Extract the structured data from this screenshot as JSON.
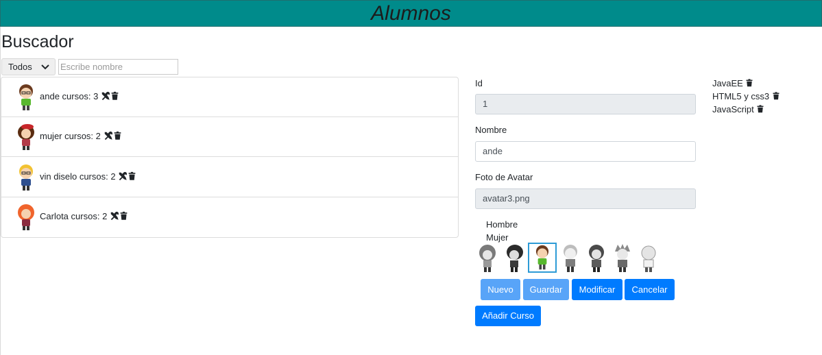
{
  "header": {
    "title": "Alumnos"
  },
  "buscador": {
    "title": "Buscador",
    "filter_selected": "Todos",
    "search_placeholder": "Escribe nombre",
    "search_value": ""
  },
  "students": [
    {
      "name": "ande",
      "courses_label": "cursos:",
      "courses_count": "3",
      "avatar_icon": "boy-brown-hair-green-shirt-avatar"
    },
    {
      "name": "mujer",
      "courses_label": "cursos:",
      "courses_count": "2",
      "avatar_icon": "girl-red-beret-avatar"
    },
    {
      "name": "vin diselo",
      "courses_label": "cursos:",
      "courses_count": "2",
      "avatar_icon": "boy-blonde-avatar"
    },
    {
      "name": "Carlota",
      "courses_label": "cursos:",
      "courses_count": "2",
      "avatar_icon": "girl-orange-hair-avatar"
    }
  ],
  "form": {
    "id_label": "Id",
    "id_value": "1",
    "nombre_label": "Nombre",
    "nombre_value": "ande",
    "foto_label": "Foto de Avatar",
    "foto_value": "avatar3.png",
    "gender_options": [
      "Hombre",
      "Mujer"
    ],
    "avatar_choices": [
      "avatar1.png",
      "avatar2.png",
      "avatar3.png",
      "avatar4.png",
      "avatar5.png",
      "avatar6.png",
      "avatar7.png"
    ],
    "selected_avatar": "avatar3.png",
    "buttons": {
      "nuevo": "Nuevo",
      "guardar": "Guardar",
      "modificar": "Modificar",
      "cancelar": "Cancelar",
      "anadir_curso": "Añadir Curso"
    }
  },
  "courses": [
    "JavaEE",
    "HTML5 y css3",
    "JavaScript"
  ],
  "colors": {
    "header_bg": "#008b8b",
    "primary": "#007bff",
    "primary_disabled": "#58a4f8",
    "selected_border": "#2d9bd6"
  }
}
